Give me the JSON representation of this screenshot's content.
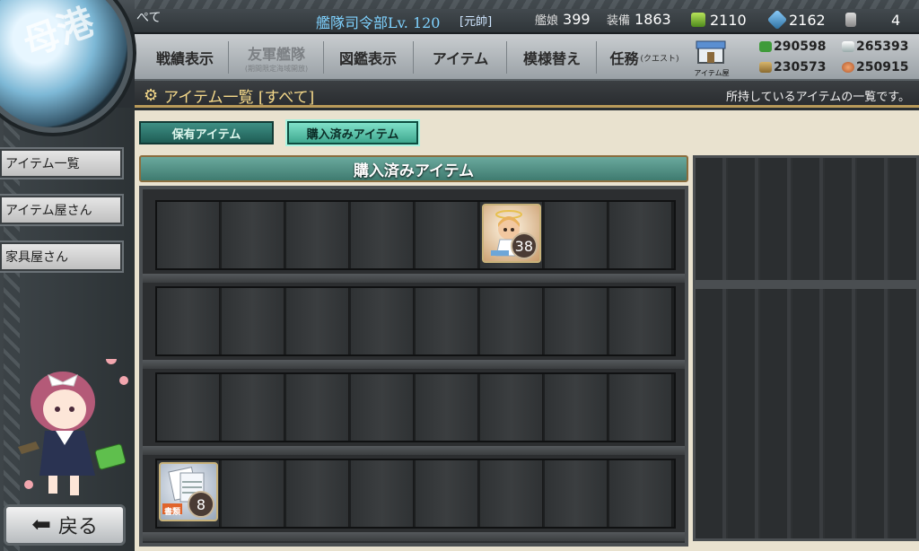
{
  "header": {
    "user_name": "ぺて",
    "hq_level": "艦隊司令部Lv. 120",
    "rank": "[元帥]",
    "ships_label": "艦娘",
    "ships": "399",
    "equip_label": "装備",
    "equip": "1863",
    "buckets": "2110",
    "dev_materials": "2162",
    "improvement_materials": "4"
  },
  "nav": {
    "items": [
      {
        "label": "戦績表示"
      },
      {
        "label": "友軍艦隊",
        "sub": "(期間限定海域開放)"
      },
      {
        "label": "図鑑表示"
      },
      {
        "label": "アイテム"
      },
      {
        "label": "模様替え"
      },
      {
        "label": "任務",
        "small": "(クエスト)"
      }
    ],
    "shop_label": "アイテム屋"
  },
  "resources": {
    "fuel": "290598",
    "ammo": "230573",
    "steel": "265393",
    "bauxite": "250915"
  },
  "page": {
    "title": "アイテム一覧 [すべて]",
    "description": "所持しているアイテムの一覧です。"
  },
  "sidebar": {
    "emblem_text": "母港",
    "items": [
      {
        "label": "アイテム一覧"
      },
      {
        "label": "アイテム屋さん"
      },
      {
        "label": "家具屋さん"
      }
    ],
    "back_label": "戻る"
  },
  "tabs": [
    {
      "label": "保有アイテム",
      "active": false
    },
    {
      "label": "購入済みアイテム",
      "active": true
    }
  ],
  "section_title": "購入済みアイテム",
  "items": [
    {
      "name": "fairy-item",
      "quantity": "38"
    },
    {
      "name": "document-item",
      "quantity": "8",
      "badge": "書類"
    }
  ],
  "colors": {
    "tab_active": "#7fe1c9",
    "tab_inactive": "#3e8f84",
    "title_gold": "#f5d98a",
    "hq_blue": "#7fd2ff"
  }
}
